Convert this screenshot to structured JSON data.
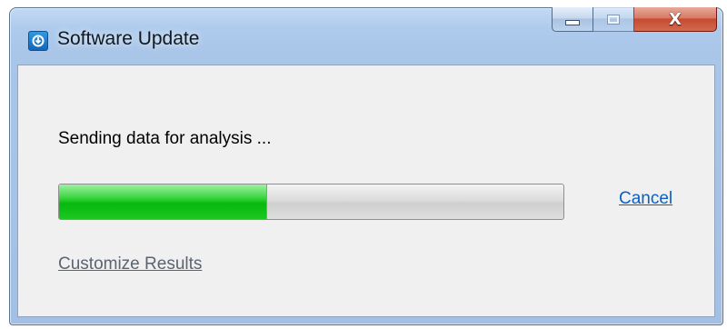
{
  "window": {
    "title": "Software Update",
    "app_icon": "software-update-icon",
    "controls": {
      "minimize": "minimize-icon",
      "maximize": "maximize-icon",
      "close": "close-icon"
    },
    "close_glyph": "X"
  },
  "content": {
    "status_text": "Sending data for analysis ...",
    "progress_fraction": 0.41,
    "cancel_label": "Cancel",
    "customize_label": "Customize Results"
  },
  "colors": {
    "progress_fill": "#1cc821",
    "link": "#0b5fc7",
    "link_muted": "#5b6470",
    "close_button": "#c74a30"
  }
}
